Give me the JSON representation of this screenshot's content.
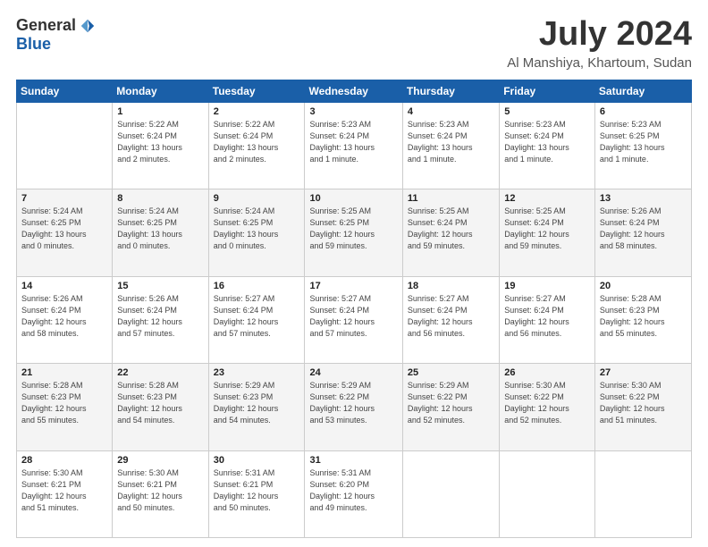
{
  "logo": {
    "general": "General",
    "blue": "Blue"
  },
  "header": {
    "month": "July 2024",
    "location": "Al Manshiya, Khartoum, Sudan"
  },
  "weekdays": [
    "Sunday",
    "Monday",
    "Tuesday",
    "Wednesday",
    "Thursday",
    "Friday",
    "Saturday"
  ],
  "weeks": [
    [
      {
        "day": "",
        "info": ""
      },
      {
        "day": "1",
        "info": "Sunrise: 5:22 AM\nSunset: 6:24 PM\nDaylight: 13 hours\nand 2 minutes."
      },
      {
        "day": "2",
        "info": "Sunrise: 5:22 AM\nSunset: 6:24 PM\nDaylight: 13 hours\nand 2 minutes."
      },
      {
        "day": "3",
        "info": "Sunrise: 5:23 AM\nSunset: 6:24 PM\nDaylight: 13 hours\nand 1 minute."
      },
      {
        "day": "4",
        "info": "Sunrise: 5:23 AM\nSunset: 6:24 PM\nDaylight: 13 hours\nand 1 minute."
      },
      {
        "day": "5",
        "info": "Sunrise: 5:23 AM\nSunset: 6:24 PM\nDaylight: 13 hours\nand 1 minute."
      },
      {
        "day": "6",
        "info": "Sunrise: 5:23 AM\nSunset: 6:25 PM\nDaylight: 13 hours\nand 1 minute."
      }
    ],
    [
      {
        "day": "7",
        "info": "Sunrise: 5:24 AM\nSunset: 6:25 PM\nDaylight: 13 hours\nand 0 minutes."
      },
      {
        "day": "8",
        "info": "Sunrise: 5:24 AM\nSunset: 6:25 PM\nDaylight: 13 hours\nand 0 minutes."
      },
      {
        "day": "9",
        "info": "Sunrise: 5:24 AM\nSunset: 6:25 PM\nDaylight: 13 hours\nand 0 minutes."
      },
      {
        "day": "10",
        "info": "Sunrise: 5:25 AM\nSunset: 6:25 PM\nDaylight: 12 hours\nand 59 minutes."
      },
      {
        "day": "11",
        "info": "Sunrise: 5:25 AM\nSunset: 6:24 PM\nDaylight: 12 hours\nand 59 minutes."
      },
      {
        "day": "12",
        "info": "Sunrise: 5:25 AM\nSunset: 6:24 PM\nDaylight: 12 hours\nand 59 minutes."
      },
      {
        "day": "13",
        "info": "Sunrise: 5:26 AM\nSunset: 6:24 PM\nDaylight: 12 hours\nand 58 minutes."
      }
    ],
    [
      {
        "day": "14",
        "info": "Sunrise: 5:26 AM\nSunset: 6:24 PM\nDaylight: 12 hours\nand 58 minutes."
      },
      {
        "day": "15",
        "info": "Sunrise: 5:26 AM\nSunset: 6:24 PM\nDaylight: 12 hours\nand 57 minutes."
      },
      {
        "day": "16",
        "info": "Sunrise: 5:27 AM\nSunset: 6:24 PM\nDaylight: 12 hours\nand 57 minutes."
      },
      {
        "day": "17",
        "info": "Sunrise: 5:27 AM\nSunset: 6:24 PM\nDaylight: 12 hours\nand 57 minutes."
      },
      {
        "day": "18",
        "info": "Sunrise: 5:27 AM\nSunset: 6:24 PM\nDaylight: 12 hours\nand 56 minutes."
      },
      {
        "day": "19",
        "info": "Sunrise: 5:27 AM\nSunset: 6:24 PM\nDaylight: 12 hours\nand 56 minutes."
      },
      {
        "day": "20",
        "info": "Sunrise: 5:28 AM\nSunset: 6:23 PM\nDaylight: 12 hours\nand 55 minutes."
      }
    ],
    [
      {
        "day": "21",
        "info": "Sunrise: 5:28 AM\nSunset: 6:23 PM\nDaylight: 12 hours\nand 55 minutes."
      },
      {
        "day": "22",
        "info": "Sunrise: 5:28 AM\nSunset: 6:23 PM\nDaylight: 12 hours\nand 54 minutes."
      },
      {
        "day": "23",
        "info": "Sunrise: 5:29 AM\nSunset: 6:23 PM\nDaylight: 12 hours\nand 54 minutes."
      },
      {
        "day": "24",
        "info": "Sunrise: 5:29 AM\nSunset: 6:22 PM\nDaylight: 12 hours\nand 53 minutes."
      },
      {
        "day": "25",
        "info": "Sunrise: 5:29 AM\nSunset: 6:22 PM\nDaylight: 12 hours\nand 52 minutes."
      },
      {
        "day": "26",
        "info": "Sunrise: 5:30 AM\nSunset: 6:22 PM\nDaylight: 12 hours\nand 52 minutes."
      },
      {
        "day": "27",
        "info": "Sunrise: 5:30 AM\nSunset: 6:22 PM\nDaylight: 12 hours\nand 51 minutes."
      }
    ],
    [
      {
        "day": "28",
        "info": "Sunrise: 5:30 AM\nSunset: 6:21 PM\nDaylight: 12 hours\nand 51 minutes."
      },
      {
        "day": "29",
        "info": "Sunrise: 5:30 AM\nSunset: 6:21 PM\nDaylight: 12 hours\nand 50 minutes."
      },
      {
        "day": "30",
        "info": "Sunrise: 5:31 AM\nSunset: 6:21 PM\nDaylight: 12 hours\nand 50 minutes."
      },
      {
        "day": "31",
        "info": "Sunrise: 5:31 AM\nSunset: 6:20 PM\nDaylight: 12 hours\nand 49 minutes."
      },
      {
        "day": "",
        "info": ""
      },
      {
        "day": "",
        "info": ""
      },
      {
        "day": "",
        "info": ""
      }
    ]
  ]
}
